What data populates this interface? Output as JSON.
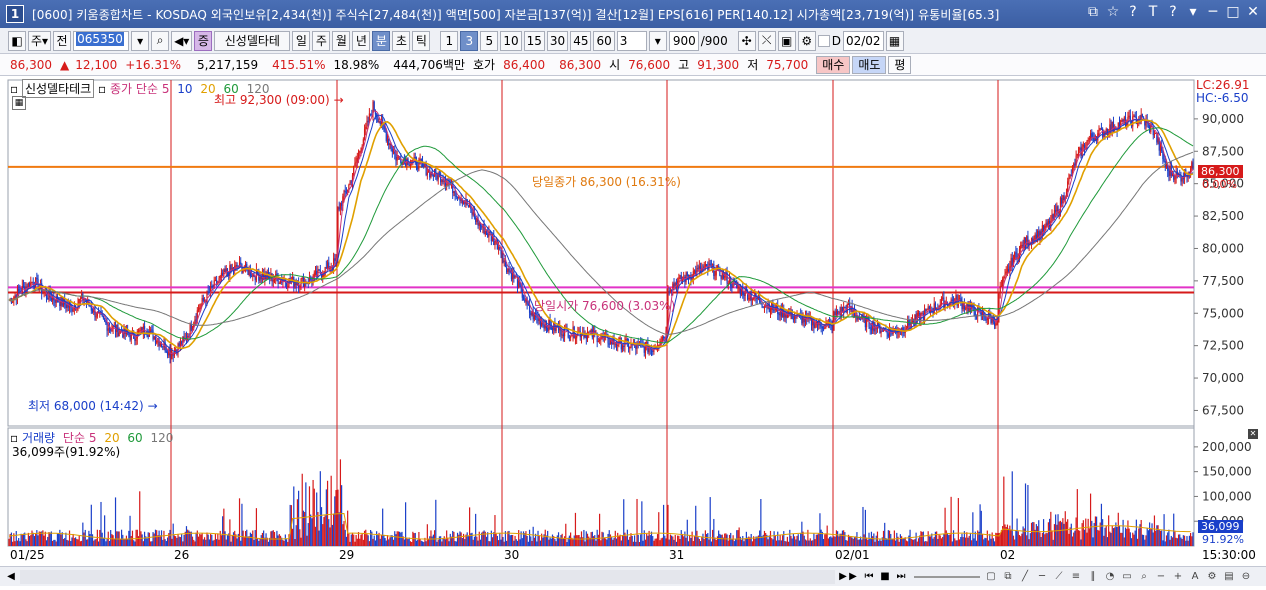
{
  "window": {
    "number": "1",
    "title": "[0600] 키움종합차트 - KOSDAQ 외국인보유[2,434(천)] 주식수[27,484(천)] 액면[500] 자본금[137(억)] 결산[12월] EPS[616] PER[140.12] 시가총액[23,719(억)] 유통비율[65.3]",
    "controls": [
      "⧉",
      "☆",
      "?",
      "T",
      "?",
      "▾",
      "─",
      "□",
      "✕"
    ]
  },
  "toolbar": {
    "period_dropdown": "주",
    "prev_label": "전",
    "code_value": "065350",
    "stock_name": "신성델타테",
    "stock_name_full": "신성델타테크",
    "period_tabs": [
      "일",
      "주",
      "월",
      "년",
      "분",
      "초",
      "틱"
    ],
    "selected_period": "분",
    "minute_options": [
      "1",
      "3",
      "5",
      "10",
      "15",
      "30",
      "45",
      "60"
    ],
    "selected_minute": "3",
    "minute_value": "3",
    "count_value": "900",
    "count_total": "/900",
    "date_value": "02/02",
    "checkbox_label": "D"
  },
  "quote": {
    "price": "86,300",
    "change_arrow": "▲",
    "change": "12,100",
    "change_pct": "+16.31%",
    "volume": "5,217,159",
    "volume_ratio": "415.51%",
    "turnover": "18.98%",
    "trade_amount": "444,706백만",
    "ask_label": "호가",
    "ask": "86,400",
    "bid": "86,300",
    "open_label": "시",
    "open": "76,600",
    "high_label": "고",
    "high": "91,300",
    "low_label": "저",
    "low": "75,700",
    "buy_label": "매수",
    "sell_label": "매도",
    "avg_label": "평"
  },
  "price_panel": {
    "legend_name": "신성델타테크",
    "legend_ma_label": "종가 단순",
    "ma_periods": [
      "5",
      "10",
      "20",
      "60",
      "120"
    ],
    "ma_colors": [
      "#c8327a",
      "#1a3fc9",
      "#e0a000",
      "#1f9a3a",
      "#777777"
    ],
    "lc_label": "LC:26.91",
    "hc_label": "HC:-6.50",
    "high_note": "최고 92,300 (09:00)",
    "low_note": "최저 68,000 (14:42)",
    "close_line_label": "당일종가 86,300 (16.31%)",
    "open_line_label": "당일시가 76,600 (3.03%)",
    "current_price_tag": "86,300",
    "current_pct_tag": "0.00%",
    "y_ticks": [
      "90,000",
      "87,500",
      "85,000",
      "82,500",
      "80,000",
      "77,500",
      "75,000",
      "72,500",
      "70,000",
      "67,500"
    ],
    "close_price": 86300,
    "open_price": 76600,
    "prev_line_price": 77000
  },
  "volume_panel": {
    "legend_name": "거래량",
    "legend_ma_label": "단순",
    "ma_periods": [
      "5",
      "20",
      "60",
      "120"
    ],
    "ma_colors": [
      "#c8327a",
      "#e0a000",
      "#1f9a3a",
      "#777777"
    ],
    "current_volume_note": "36,099주(91.92%)",
    "current_volume_tag": "36,099",
    "current_pct_tag": "91.92%",
    "y_ticks": [
      "200,000",
      "150,000",
      "100,000",
      "50,000"
    ]
  },
  "x_axis": {
    "labels": [
      "01/25",
      "26",
      "29",
      "30",
      "31",
      "02/01",
      "02"
    ],
    "time_label": "15:30:00"
  },
  "chart_data": {
    "type": "candlestick",
    "description_days": [
      "01/25",
      "26",
      "29",
      "30",
      "31",
      "02/01",
      "02"
    ],
    "y_range": [
      66300,
      93000
    ],
    "close_segments": [
      {
        "day": "01/25",
        "start": 76000,
        "points": [
          76800,
          77500,
          76400,
          76000,
          75400,
          76200,
          75000,
          74000,
          73600,
          73200,
          73800,
          73000,
          72000
        ]
      },
      {
        "day": "26",
        "start": 72000,
        "points": [
          73000,
          75500,
          77000,
          78200,
          78600,
          78000,
          77800,
          77600,
          77400,
          77500,
          78200,
          79000
        ]
      },
      {
        "day": "29",
        "start": 83000,
        "points": [
          85000,
          88000,
          91000,
          89000,
          87000,
          86800,
          86500,
          85800,
          85500,
          84500,
          83500,
          82000,
          81000,
          80000
        ]
      },
      {
        "day": "30",
        "start": 79000,
        "points": [
          77500,
          75000,
          74200,
          73800,
          73500,
          73500,
          73200,
          72800,
          72600,
          72400,
          72300,
          73500
        ]
      },
      {
        "day": "31",
        "start": 77000,
        "points": [
          77600,
          78200,
          78500,
          78000,
          77000,
          76400,
          75800,
          75200,
          74900,
          74500,
          74200,
          74000
        ]
      },
      {
        "day": "02/01",
        "start": 74800,
        "points": [
          75500,
          74500,
          74000,
          73600,
          73800,
          74500,
          75200,
          75800,
          76000,
          75400,
          74800,
          74400
        ]
      },
      {
        "day": "02",
        "start": 76600,
        "points": [
          79000,
          80500,
          81000,
          82000,
          84000,
          87000,
          88500,
          89000,
          89500,
          89800,
          90000,
          89000,
          86000,
          85500,
          86300
        ]
      }
    ]
  }
}
